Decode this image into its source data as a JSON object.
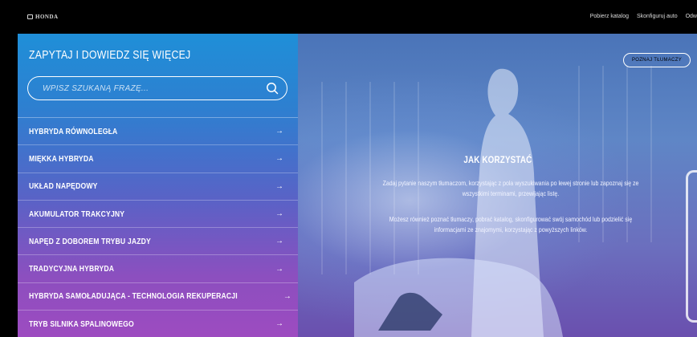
{
  "topbar": {
    "logo_text": "HONDA",
    "nav": [
      "Pobierz katalog",
      "Skonfiguruj auto",
      "Odw"
    ]
  },
  "panel": {
    "title": "ZAPYTAJ I DOWIEDZ SIĘ WIĘCEJ",
    "search_placeholder": "WPISZ SZUKANĄ FRAZĘ...",
    "items": [
      "HYBRYDA RÓWNOLEGŁA",
      "MIĘKKA HYBRYDA",
      "UKŁAD NAPĘDOWY",
      "AKUMULATOR TRAKCYJNY",
      "NAPĘD Z DOBOREM TRYBU JAZDY",
      "TRADYCYJNA HYBRYDA",
      "HYBRYDA SAMOŁADUJĄCA - TECHNOLOGIA REKUPERACJI",
      "TRYB SILNIKA SPALINOWEGO"
    ],
    "arrow_glyph": "→"
  },
  "hero": {
    "button_label": "POZNAJ TŁUMACZY",
    "title": "JAK KORZYSTAĆ",
    "paragraph1": "Zadaj pytanie naszym tłumaczom, korzystając z pola wyszukiwania po lewej stronie lub zapoznaj się ze wszystkimi terminami, przewijając listę.",
    "paragraph2": "Możesz również poznać tłumaczy, pobrać katalog, skonfigurować swój samochód lub podzielić się informacjami ze znajomymi, korzystając z powyższych linków."
  },
  "colors": {
    "panel_top": "#1f8fd8",
    "panel_bottom": "#9d4bc0",
    "topbar": "#000000"
  }
}
